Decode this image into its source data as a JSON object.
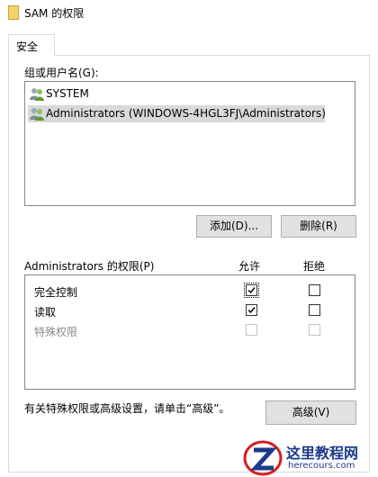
{
  "window": {
    "title": "SAM 的权限"
  },
  "tabs": [
    {
      "label": "安全"
    }
  ],
  "groups_label": "组或用户名(G):",
  "users": [
    {
      "label": "SYSTEM"
    },
    {
      "label": "Administrators (WINDOWS-4HGL3FJ\\Administrators)"
    }
  ],
  "buttons": {
    "add": "添加(D)...",
    "remove": "删除(R)",
    "advanced": "高级(V)"
  },
  "permissions": {
    "header": "Administrators 的权限(P)",
    "allow_header": "允许",
    "deny_header": "拒绝",
    "rows": [
      {
        "label": "完全控制",
        "allow": true,
        "deny": false,
        "enabled": true
      },
      {
        "label": "读取",
        "allow": true,
        "deny": false,
        "enabled": true
      },
      {
        "label": "特殊权限",
        "allow": false,
        "deny": false,
        "enabled": false
      }
    ]
  },
  "advanced_hint": "有关特殊权限或高级设置，请单击“高级”。",
  "watermark": {
    "name": "这里教程网",
    "url": "herecours.com"
  },
  "colors": {
    "selection": "#d9d9d9",
    "button_bg": "#e1e1e1",
    "logo_red": "#d21f1f",
    "logo_blue": "#1a3a8a"
  }
}
